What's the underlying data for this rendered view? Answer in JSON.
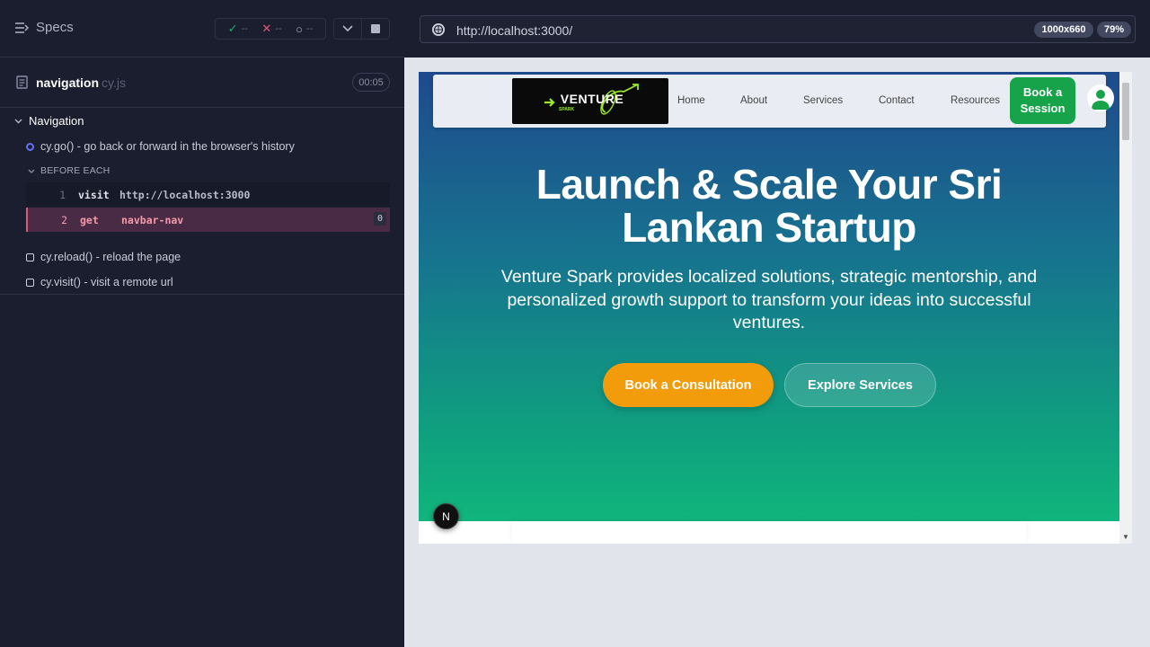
{
  "reporter": {
    "specs_label": "Specs",
    "stats": {
      "passed": "--",
      "failed": "--",
      "pending": "--"
    },
    "spec": {
      "name": "navigation",
      "ext": "cy.js",
      "duration": "00:05"
    },
    "suite": "Navigation",
    "tests": [
      {
        "title": "cy.go() - go back or forward in the browser's history",
        "state": "running"
      },
      {
        "title": "cy.reload() - reload the page",
        "state": "pending"
      },
      {
        "title": "cy.visit() - visit a remote url",
        "state": "pending"
      }
    ],
    "hook_label": "BEFORE EACH",
    "commands": [
      {
        "num": "1",
        "name": "visit",
        "arg": "http://localhost:3000"
      },
      {
        "num": "2",
        "name": "get",
        "arg": "navbar-nav",
        "count": "0"
      }
    ]
  },
  "aut": {
    "url": "http://localhost:3000/",
    "viewport_size": "1000x660",
    "zoom": "79%",
    "site": {
      "logo_text": "VENTURE",
      "logo_sub": "SPARK",
      "nav": [
        "Home",
        "About",
        "Services",
        "Contact",
        "Resources"
      ],
      "book_session": "Book a Session",
      "hero_title": "Launch & Scale Your Sri Lankan Startup",
      "hero_subtitle": "Venture Spark provides localized solutions, strategic mentorship, and personalized growth support to transform your ideas into successful ventures.",
      "cta_primary": "Book a Consultation",
      "cta_secondary": "Explore Services",
      "next_badge": "N"
    }
  },
  "colors": {
    "reporter_bg": "#1b1e2e",
    "passed": "#1fa971",
    "failed": "#e45770",
    "running": "#6470f3",
    "book_btn": "#16a34a",
    "cta_primary": "#f39c0b"
  }
}
